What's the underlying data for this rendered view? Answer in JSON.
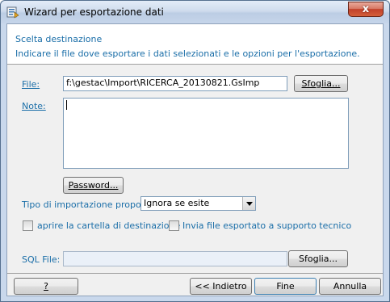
{
  "window": {
    "title": "Wizard per esportazione dati",
    "close_label": "x"
  },
  "header": {
    "heading": "Scelta destinazione",
    "subheading": "Indicare il file dove esportare i dati selezionati e le opzioni per l'esportazione."
  },
  "form": {
    "file_label": "File:",
    "file_value": "f:\\gestac\\Import\\RICERCA_20130821.GsImp",
    "browse_label": "Sfoglia...",
    "note_label": "Note:",
    "note_value": "",
    "password_label": "Password...",
    "import_type_label": "Tipo di importazione proposta:",
    "import_type_value": "Ignora se esite",
    "open_folder_label": "aprire la cartella di destinazione",
    "open_folder_checked": false,
    "send_support_label": "Invia file esportato a supporto tecnico",
    "send_support_checked": false,
    "sql_file_label": "SQL File:",
    "sql_file_value": "",
    "sql_browse_label": "Sfoglia..."
  },
  "footer": {
    "help_label": "?",
    "back_label": "<< Indietro",
    "finish_label": "Fine",
    "cancel_label": "Annulla"
  }
}
